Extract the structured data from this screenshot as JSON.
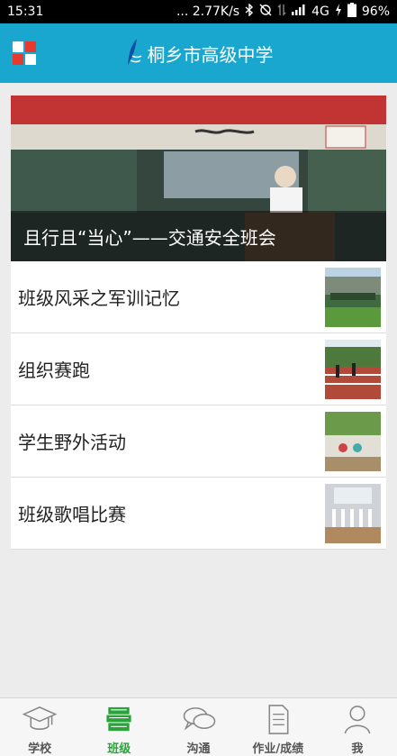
{
  "status_bar": {
    "time": "15:31",
    "network_speed": "... 2.77K/s",
    "signal_type": "4G",
    "battery": "96%"
  },
  "header": {
    "title": "桐乡市高级中学"
  },
  "hero": {
    "caption": "且行且“当心”——交通安全班会"
  },
  "list": [
    {
      "title": "班级风采之军训记忆"
    },
    {
      "title": "组织赛跑"
    },
    {
      "title": "学生野外活动"
    },
    {
      "title": "班级歌唱比赛"
    }
  ],
  "bottom_nav": [
    {
      "label": "学校",
      "icon": "graduation-cap-icon",
      "active": false
    },
    {
      "label": "班级",
      "icon": "books-icon",
      "active": true
    },
    {
      "label": "沟通",
      "icon": "chat-bubbles-icon",
      "active": false
    },
    {
      "label": "作业/成绩",
      "icon": "document-icon",
      "active": false
    },
    {
      "label": "我",
      "icon": "person-icon",
      "active": false
    }
  ],
  "colors": {
    "header": "#1aa7cf",
    "active_tab": "#2aa33a",
    "menu_red": "#e63a2e"
  }
}
